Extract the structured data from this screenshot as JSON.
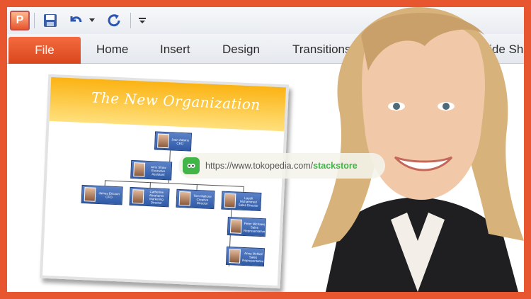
{
  "ribbon": {
    "tabs": [
      "File",
      "Home",
      "Insert",
      "Design",
      "Transitions",
      "Slide Sh"
    ]
  },
  "slide": {
    "title": "The New Organization",
    "nodes": [
      {
        "name": "Joan Adams",
        "role": "CEO"
      },
      {
        "name": "Amy Shaw",
        "role": "Executive Assistant"
      },
      {
        "name": "James Ericson",
        "role": "CFO"
      },
      {
        "name": "Catherine Abrahams",
        "role": "Marketing Director"
      },
      {
        "name": "Tom Mallone",
        "role": "Creative Director"
      },
      {
        "name": "Layali Mohammed",
        "role": "Sales Director"
      },
      {
        "name": "Peter Michaels",
        "role": "Sales Representative"
      },
      {
        "name": "Anna McNeil",
        "role": "Sales Representative"
      }
    ]
  },
  "watermark": {
    "url_prefix": "https://www.tokopedia.com/",
    "url_store": "stackstore"
  },
  "colors": {
    "border": "#e8562f",
    "file_tab": "#e8562f",
    "title_gradient": "#fbb313",
    "box": "#2f5aa6",
    "tokopedia": "#42b549"
  },
  "icons": [
    "powerpoint-logo-icon",
    "save-icon",
    "undo-icon",
    "dropdown-arrow-icon",
    "redo-icon",
    "customize-toolbar-icon"
  ]
}
